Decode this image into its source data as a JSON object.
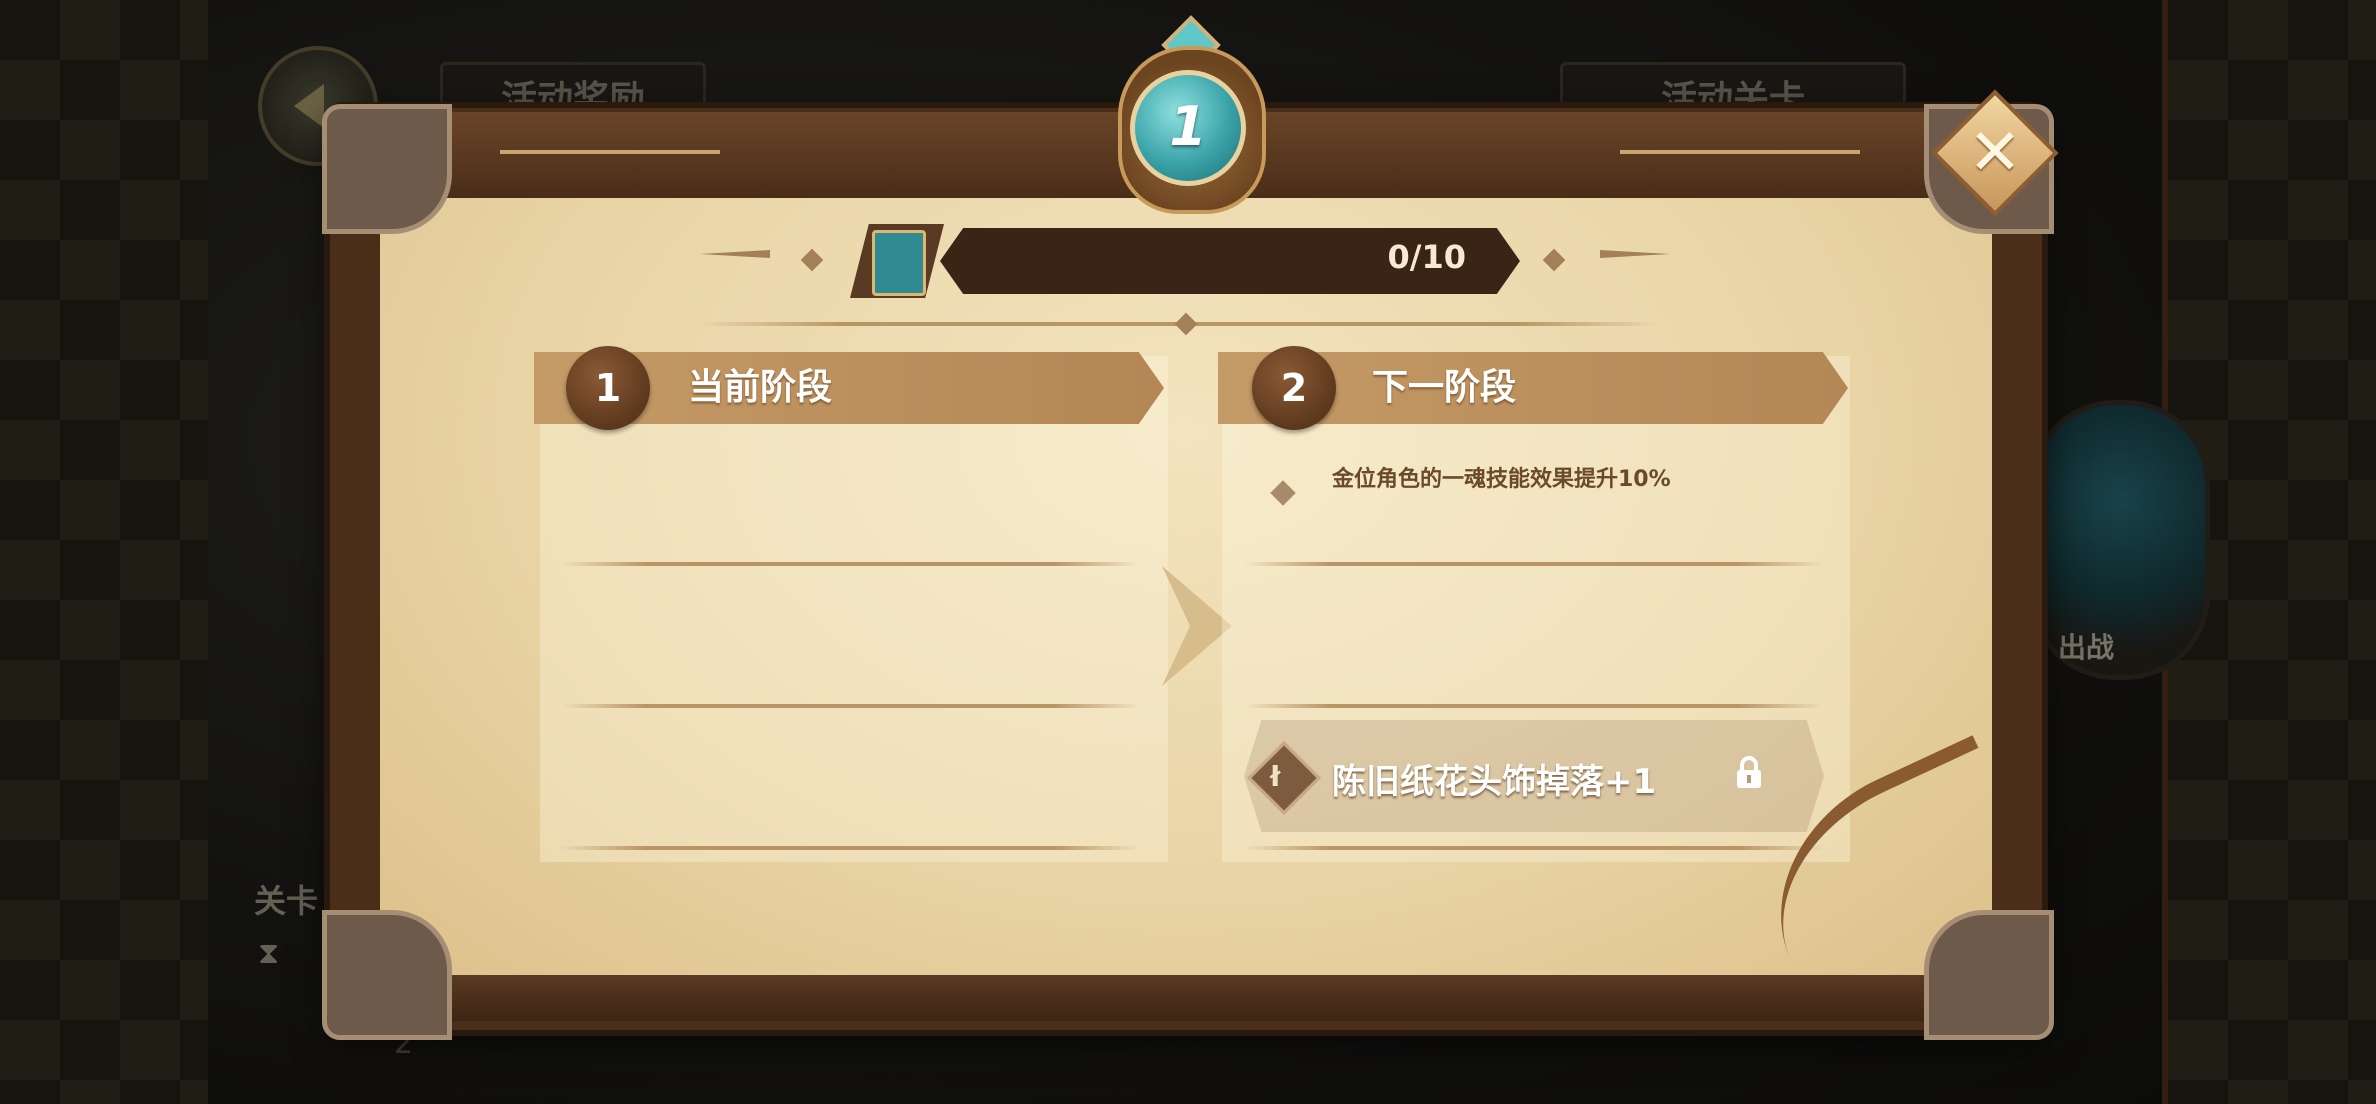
{
  "background": {
    "tab_rewards": "活动奖励",
    "tab_stages": "活动关卡",
    "battle_label": "出战",
    "stage_text": "关卡",
    "timer_text": "",
    "page_num": "2"
  },
  "dialog": {
    "level": "1",
    "progress": {
      "text": "0/10",
      "current": 0,
      "max": 10
    },
    "current_stage": {
      "number": "1",
      "title": "当前阶段"
    },
    "next_stage": {
      "number": "2",
      "title": "下一阶段",
      "effect": "金位角色的一魂技能效果提升10%",
      "reward": "陈旧纸花头饰掉落+1",
      "reward_locked": true
    },
    "close_label": "✕"
  },
  "colors": {
    "parchment": "#ecd9ad",
    "frame_brown": "#4b2e1a",
    "header_tan": "#c49a66",
    "medal_teal": "#3aa3a8"
  }
}
